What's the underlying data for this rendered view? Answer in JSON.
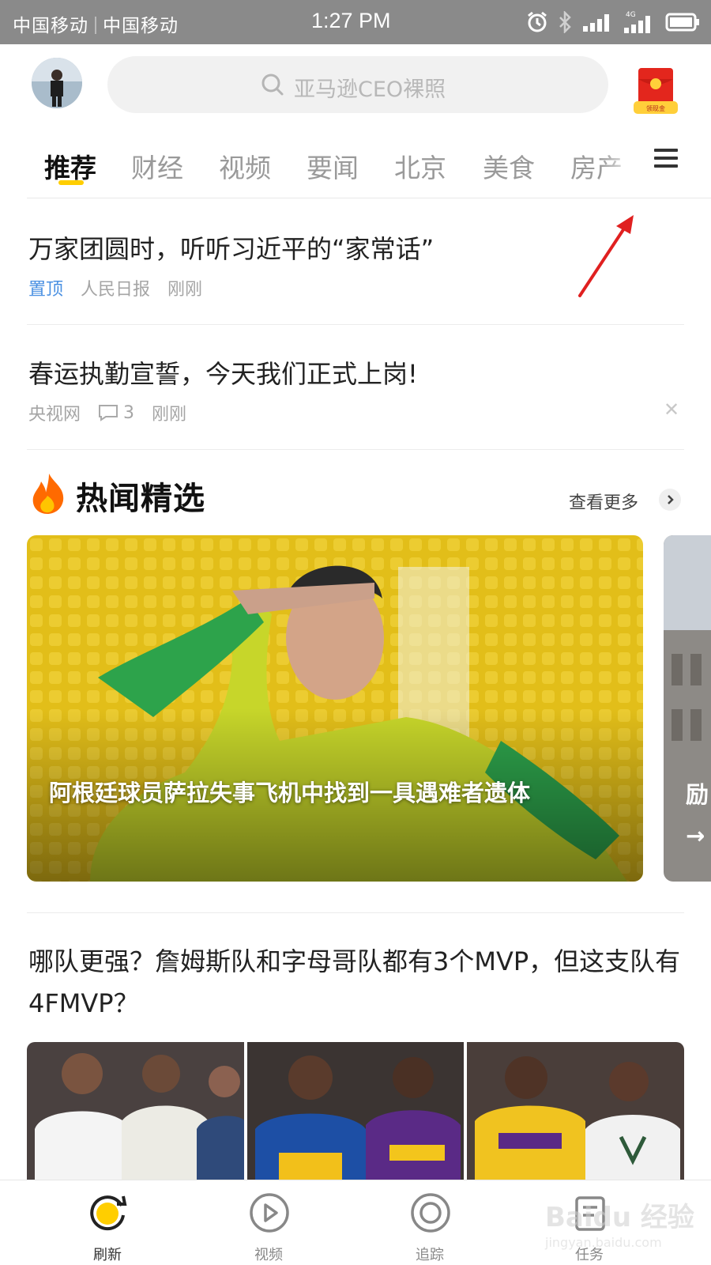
{
  "status_bar": {
    "carrier_1": "中国移动",
    "carrier_2": "中国移动",
    "time": "1:27 PM",
    "network": "4G"
  },
  "header": {
    "search_placeholder": "亚马逊CEO裸照",
    "redpacket_label": "领现金"
  },
  "tabs": [
    {
      "label": "推荐",
      "active": true
    },
    {
      "label": "财经"
    },
    {
      "label": "视频"
    },
    {
      "label": "要闻"
    },
    {
      "label": "北京"
    },
    {
      "label": "美食"
    },
    {
      "label": "房产"
    }
  ],
  "feed": {
    "items": [
      {
        "title": "万家团圆时，听听习近平的“家常话”",
        "tag": "置顶",
        "source": "人民日报",
        "time": "刚刚"
      },
      {
        "title": "春运执勤宣誓，今天我们正式上岗!",
        "source": "央视网",
        "comments": "3",
        "time": "刚刚"
      }
    ]
  },
  "hot": {
    "title": "热闻精选",
    "more": "查看更多",
    "cards": [
      {
        "caption": "阿根廷球员萨拉失事飞机中找到一具遇难者遗体"
      },
      {
        "caption": "励\n→"
      }
    ]
  },
  "article": {
    "title": "哪队更强？詹姆斯队和字母哥队都有3个MVP，但这支队有4FMVP？"
  },
  "bottom_nav": [
    {
      "label": "刷新",
      "icon": "refresh-icon",
      "active": true
    },
    {
      "label": "视频",
      "icon": "play-icon"
    },
    {
      "label": "追踪",
      "icon": "target-icon"
    },
    {
      "label": "任务",
      "icon": "task-icon"
    }
  ],
  "watermark": {
    "brand": "Baidu 经验",
    "url": "jingyan.baidu.com"
  },
  "colors": {
    "accent": "#ffce00",
    "pin": "#4a90e2",
    "annotation": "#e02020"
  }
}
